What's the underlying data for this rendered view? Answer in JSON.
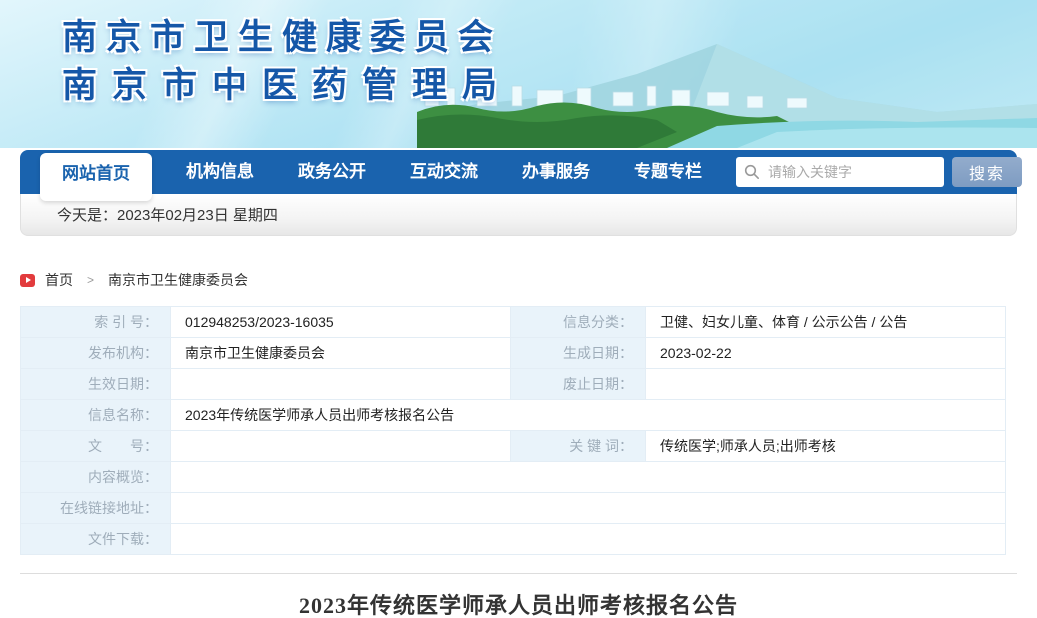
{
  "header": {
    "org_line1": "南京市卫生健康委员会",
    "org_line2": "南京市中医药管理局"
  },
  "nav": {
    "tabs": [
      {
        "label": "网站首页",
        "active": true
      },
      {
        "label": "机构信息",
        "active": false
      },
      {
        "label": "政务公开",
        "active": false
      },
      {
        "label": "互动交流",
        "active": false
      },
      {
        "label": "办事服务",
        "active": false
      },
      {
        "label": "专题专栏",
        "active": false
      }
    ],
    "search": {
      "placeholder": "请输入关键字",
      "button_label": "搜索",
      "icon": "search-icon"
    }
  },
  "date_bar": {
    "text": "今天是：2023年02月23日 星期四"
  },
  "breadcrumb": {
    "icon": "play-icon",
    "home": "首页",
    "separator": ">",
    "current": "南京市卫生健康委员会"
  },
  "info_table": {
    "rows": [
      {
        "label1": "索 引 号：",
        "value1": "012948253/2023-16035",
        "label2": "信息分类：",
        "value2": "卫健、妇女儿童、体育 / 公示公告 / 公告"
      },
      {
        "label1": "发布机构：",
        "value1": "南京市卫生健康委员会",
        "label2": "生成日期：",
        "value2": "2023-02-22"
      },
      {
        "label1": "生效日期：",
        "value1": "",
        "label2": "废止日期：",
        "value2": ""
      },
      {
        "label1": "信息名称：",
        "value1": "2023年传统医学师承人员出师考核报名公告"
      },
      {
        "label1": "文　　号：",
        "value1": "",
        "label2": "关 键 词：",
        "value2": "传统医学;师承人员;出师考核"
      },
      {
        "label1": "内容概览：",
        "value1": ""
      },
      {
        "label1": "在线链接地址：",
        "value1": ""
      },
      {
        "label1": "文件下载：",
        "value1": ""
      }
    ]
  },
  "article": {
    "title": "2023年传统医学师承人员出师考核报名公告"
  },
  "colors": {
    "nav_blue": "#1a63ae",
    "banner_text_blue": "#1557a8",
    "breadcrumb_icon_red": "#e23b3d",
    "table_label_bg": "#e9f3fa",
    "table_label_text": "#9fadba",
    "search_button_blue": "#7e9cc2"
  }
}
